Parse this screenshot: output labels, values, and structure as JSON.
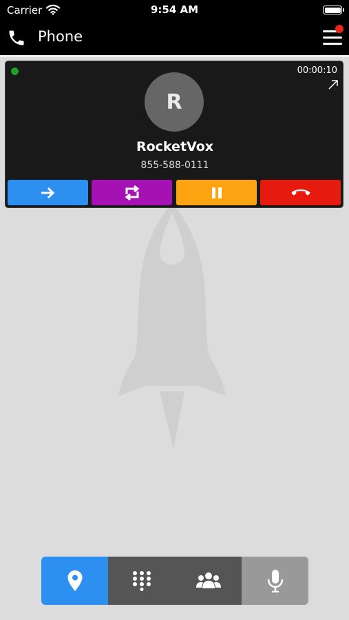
{
  "status_bar": {
    "carrier": "Carrier",
    "time": "9:54 AM",
    "icons": [
      "wifi-icon",
      "battery-icon"
    ]
  },
  "header": {
    "title": "Phone",
    "icons": [
      "phone-icon",
      "menu-icon"
    ],
    "notification_color": "#e8271a"
  },
  "call": {
    "avatar_initial": "R",
    "name": "RocketVox",
    "number": "855-588-0111",
    "duration": "00:00:10",
    "status_color": "#1f9e2a",
    "actions": [
      {
        "name": "transfer",
        "icon": "arrow-right-icon",
        "color": "#2d8ff0"
      },
      {
        "name": "swap",
        "icon": "swap-icon",
        "color": "#a611b3"
      },
      {
        "name": "hold",
        "icon": "pause-icon",
        "color": "#fca311"
      },
      {
        "name": "hangup",
        "icon": "hangup-icon",
        "color": "#e61a0f"
      }
    ]
  },
  "bottom_nav": {
    "items": [
      {
        "name": "location",
        "icon": "location-pin-icon",
        "color": "#2d8ff0",
        "active": true
      },
      {
        "name": "keypad",
        "icon": "keypad-icon",
        "color": "#555555",
        "active": false
      },
      {
        "name": "contacts",
        "icon": "contacts-icon",
        "color": "#555555",
        "active": false
      },
      {
        "name": "microphone",
        "icon": "microphone-icon",
        "color": "#999999",
        "active": false
      }
    ]
  }
}
